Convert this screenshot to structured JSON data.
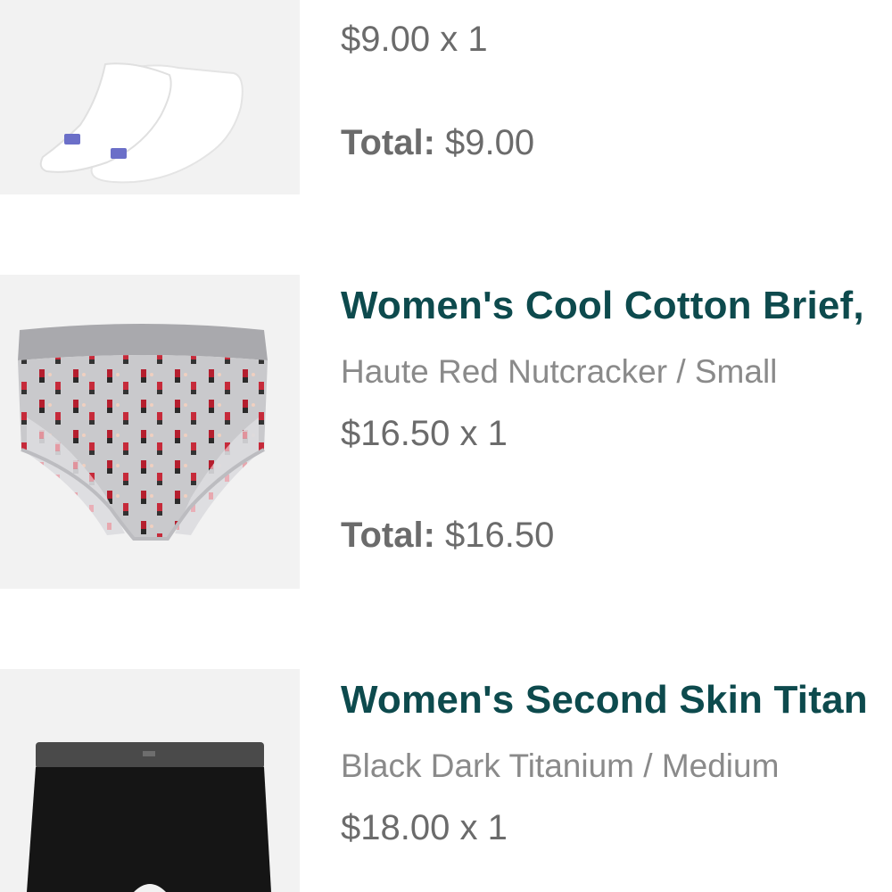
{
  "items": [
    {
      "name": "",
      "variant": "",
      "price": "$9.00 x 1",
      "total_label": "Total:",
      "total_value": "$9.00",
      "image_icon": "socks-image"
    },
    {
      "name": "Women's Cool Cotton Brief,",
      "variant": "Haute Red Nutcracker / Small",
      "price": "$16.50 x 1",
      "total_label": "Total:",
      "total_value": "$16.50",
      "image_icon": "brief-image"
    },
    {
      "name": "Women's Second Skin Titan",
      "variant": "Black Dark Titanium / Medium",
      "price": "$18.00 x 1",
      "image_icon": "boyshort-image"
    }
  ],
  "colors": {
    "title": "#0d4a4d",
    "price": "#6b6b6b",
    "variant": "#8a8a8a",
    "thumb_bg": "#f2f2f2"
  }
}
